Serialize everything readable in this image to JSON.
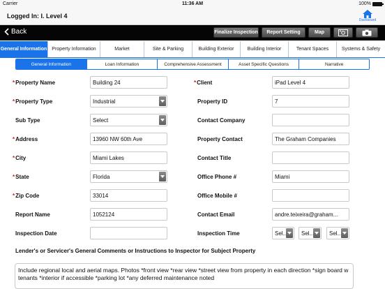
{
  "status_bar": {
    "carrier": "Carrier",
    "time": "11:36 AM",
    "battery": "100%"
  },
  "header": {
    "login_text": "Logged In: I. Level 4",
    "dashboard_label": "Dashboard"
  },
  "toolbar": {
    "back_label": "Back",
    "finalize_label": "Finalize Inspection",
    "report_label": "Report Setting",
    "map_label": "Map",
    "photo_icon": "photo-icon",
    "camera_icon": "camera-icon"
  },
  "main_tabs": [
    "General Information",
    "Property Information",
    "Market",
    "Site & Parking",
    "Building Exterior",
    "Building Interior",
    "Tenant Spaces",
    "Systems & Safety"
  ],
  "sub_tabs": [
    "General Information",
    "Loan Information",
    "Comprehensive Assessment",
    "Asset Specific Questions",
    "Narrative"
  ],
  "form": {
    "property_name": {
      "label": "Property Name",
      "value": "Building 24"
    },
    "client": {
      "label": "Client",
      "value": "iPad  Level 4"
    },
    "property_type": {
      "label": "Property Type",
      "value": "Industrial"
    },
    "property_id": {
      "label": "Property ID",
      "value": "7"
    },
    "sub_type": {
      "label": "Sub Type",
      "value": "Select"
    },
    "contact_company": {
      "label": "Contact Company",
      "value": ""
    },
    "address": {
      "label": "Address",
      "value": "13960 NW 60th Ave"
    },
    "property_contact": {
      "label": "Property Contact",
      "value": "The Graham Companies"
    },
    "city": {
      "label": "City",
      "value": "Miami Lakes"
    },
    "contact_title": {
      "label": "Contact Title",
      "value": ""
    },
    "state": {
      "label": "State",
      "value": "Florida"
    },
    "office_phone": {
      "label": "Office Phone #",
      "value": "Miami"
    },
    "zip_code": {
      "label": "Zip Code",
      "value": "33014"
    },
    "office_mobile": {
      "label": "Office Mobile #",
      "value": ""
    },
    "report_name": {
      "label": "Report Name",
      "value": "1052124"
    },
    "contact_email": {
      "label": "Contact Email",
      "value": "andre.teixeira@graham..."
    },
    "inspection_date": {
      "label": "Inspection Date",
      "value": ""
    },
    "inspection_time": {
      "label": "Inspection Time",
      "hour": "Sel...",
      "minute": "Sel...",
      "ampm": "Sel..."
    }
  },
  "comments": {
    "label": "Lender's or Servicer's General Comments or Instructions to Inspector for Subject Property",
    "value": "Include regional local and aerial maps. Photos *front view *rear view *street view from property in each direction *sign board w tenants *interior if accessible *parking lot *any deferred maintenance noted"
  },
  "colors": {
    "accent": "#1a73e8",
    "toolbar": "#050505",
    "required": "#d21b1b"
  }
}
